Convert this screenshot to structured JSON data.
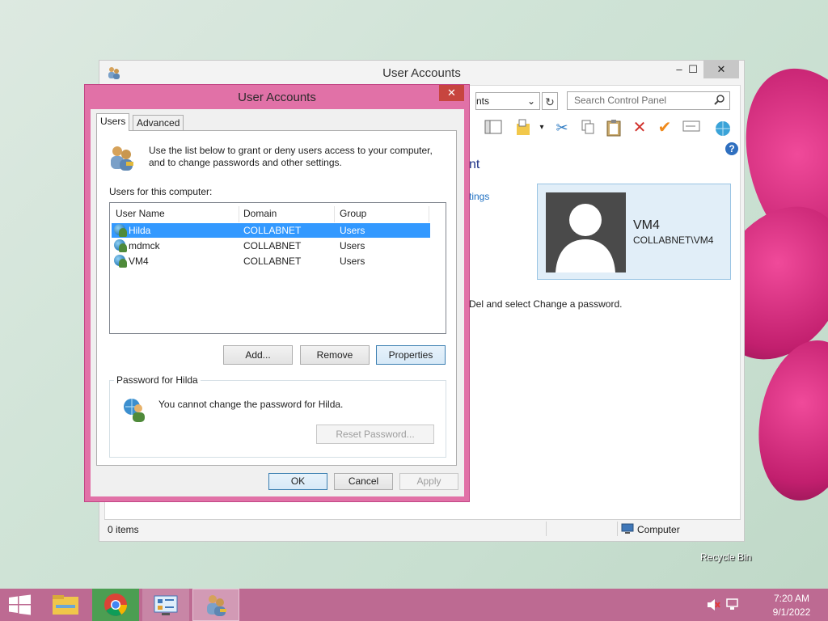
{
  "desktop": {
    "recycle_bin_label": "Recycle Bin"
  },
  "background_window": {
    "title": "User Accounts",
    "minimize_glyph": "–",
    "maximize_glyph": "☐",
    "close_glyph": "✕",
    "address_text": "nts",
    "search_placeholder": "Search Control Panel",
    "heading_fragment": "nt",
    "link_fragment": "tings",
    "instruction_fragment": "Del and select Change a password.",
    "user_card": {
      "name": "VM4",
      "account": "COLLABNET\\VM4"
    },
    "status_items": "0 items",
    "status_zone": "Computer",
    "help_glyph": "?"
  },
  "dialog": {
    "title": "User Accounts",
    "close_glyph": "✕",
    "tabs": [
      {
        "label": "Users",
        "active": true
      },
      {
        "label": "Advanced",
        "active": false
      }
    ],
    "intro_text_line1": "Use the list below to grant or deny users access to your computer,",
    "intro_text_line2": "and to change passwords and other settings.",
    "list_label": "Users for this computer:",
    "columns": [
      "User Name",
      "Domain",
      "Group"
    ],
    "rows": [
      {
        "user": "Hilda",
        "domain": "COLLABNET",
        "group": "Users",
        "selected": true
      },
      {
        "user": "mdmck",
        "domain": "COLLABNET",
        "group": "Users",
        "selected": false
      },
      {
        "user": "VM4",
        "domain": "COLLABNET",
        "group": "Users",
        "selected": false
      }
    ],
    "buttons": {
      "add": "Add...",
      "remove": "Remove",
      "properties": "Properties",
      "reset_password": "Reset Password...",
      "ok": "OK",
      "cancel": "Cancel",
      "apply": "Apply"
    },
    "password_group_label": "Password for Hilda",
    "password_message": "You cannot change the password for Hilda."
  },
  "taskbar": {
    "time": "7:20 AM",
    "date": "9/1/2022",
    "apps": [
      "start-button",
      "file-explorer",
      "chrome",
      "control-panel",
      "user-accounts"
    ]
  },
  "colors": {
    "dialog_frame": "#e171a7",
    "selection": "#3399ff",
    "taskbar": "#bd6a92",
    "close_button": "#c7453f"
  }
}
